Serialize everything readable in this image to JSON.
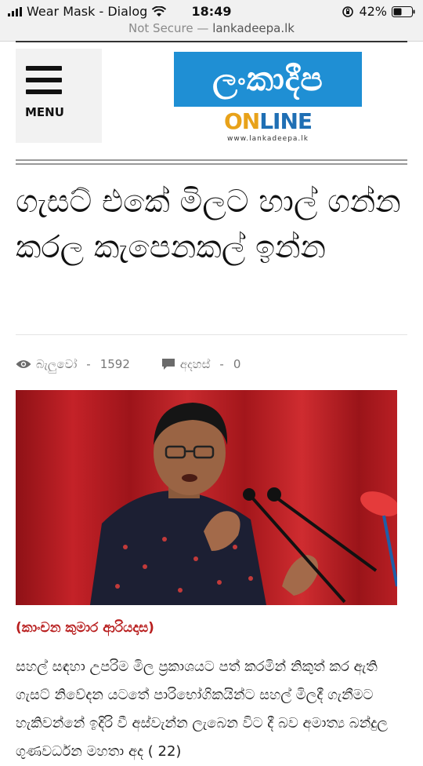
{
  "status_bar": {
    "carrier": "Wear Mask - Dialog",
    "time": "18:49",
    "battery": "42%"
  },
  "browser": {
    "not_secure": "Not Secure",
    "separator": "—",
    "domain": "lankadeepa.lk"
  },
  "site": {
    "menu_label": "MENU",
    "logo_text": "ලංකාදීප",
    "logo_online_a": "ON",
    "logo_online_b": "LINE",
    "logo_url": "www.lankadeepa.lk"
  },
  "article": {
    "title": "ගැසට් එකේ මිලට හාල් ගන්න කරල කැපෙනකල් ඉන්න",
    "views_label": "බැලුවෝ",
    "views_count": "1592",
    "comments_label": "අදහස්",
    "comments_count": "0",
    "author": "(කාංචන කුමාර ආරියදාස)",
    "body": "සහල් සඳහා උපරිම මිල ප්‍රකාශයට පත් කරමින් නිකුත් කර ඇති ගැසට් නිවේදන යටතේ පාරිභෝගිකයින්ට සහල් මිලදී ගැනීමට හැකිවන්නේ ඉදිරි වී අස්වැන්න ලැබෙන විට දී බව අමාත්‍ය බන්දුල ගුණවර්ධන මහතා අද ( 22)"
  },
  "colors": {
    "accent_red": "#b81e1e",
    "logo_blue": "#1f8fd4",
    "photo_bg": "#a5161c"
  }
}
